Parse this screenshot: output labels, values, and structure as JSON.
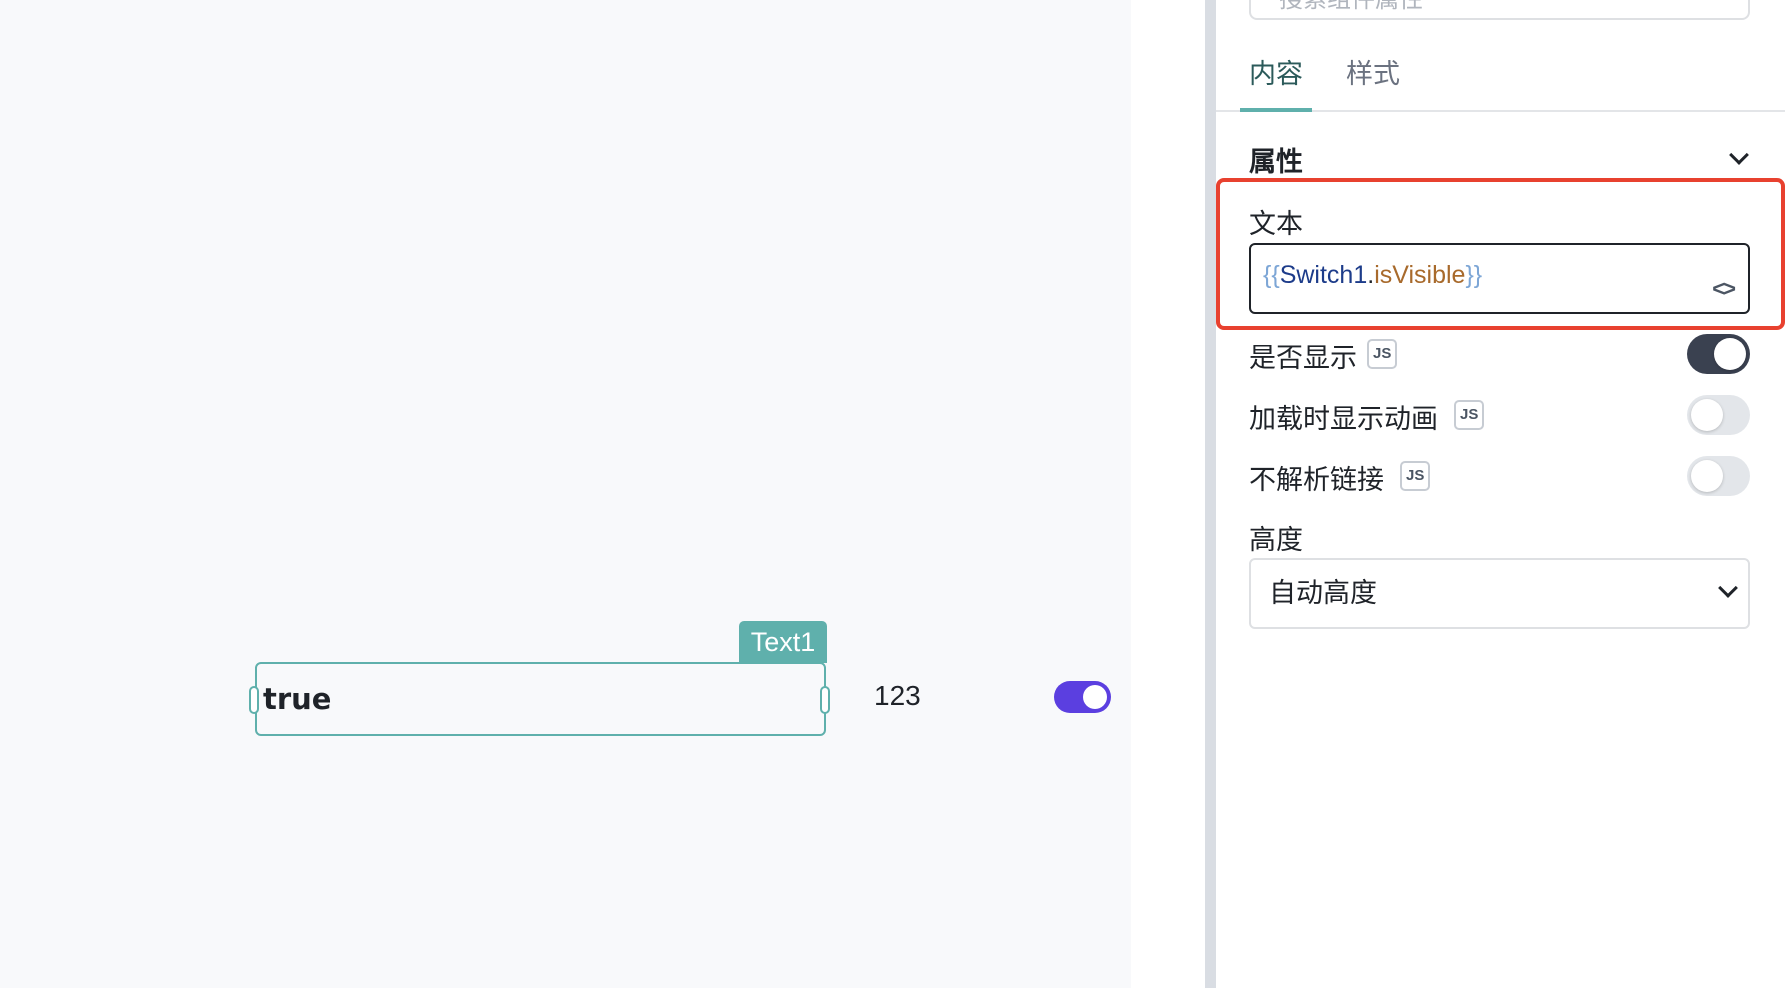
{
  "canvas": {
    "component_tag": "Text1",
    "component_text": "true",
    "number_label": "123",
    "switch_on": true
  },
  "panel": {
    "search_placeholder": "搜索组件属性",
    "tabs": [
      {
        "label": "内容",
        "active": true
      },
      {
        "label": "样式",
        "active": false
      }
    ],
    "section_title": "属性",
    "text_field": {
      "label": "文本",
      "value_open": "{{",
      "value_object": "Switch1",
      "value_dot": ".",
      "value_property": "isVisible",
      "value_close": "}}"
    },
    "toggles": [
      {
        "label": "是否显示",
        "badge": "JS",
        "on": true
      },
      {
        "label": "加载时显示动画",
        "badge": "JS",
        "on": false
      },
      {
        "label": "不解析链接",
        "badge": "JS",
        "on": false
      }
    ],
    "height_field": {
      "label": "高度",
      "value": "自动高度"
    }
  },
  "colors": {
    "accent": "#5fb0ac",
    "highlight": "#e8412f",
    "switch_purple": "#5b3fe0"
  }
}
